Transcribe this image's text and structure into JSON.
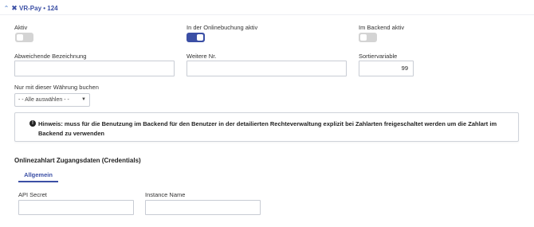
{
  "header": {
    "collapse_icon": "chevron-up",
    "method_icon": "x-mark",
    "title": "VR-Pay • 124"
  },
  "toggles": {
    "aktiv": {
      "label": "Aktiv",
      "on": false
    },
    "online": {
      "label": "In der Onlinebuchung aktiv",
      "on": true
    },
    "backend": {
      "label": "Im Backend aktiv",
      "on": false
    }
  },
  "fields": {
    "bezeichnung": {
      "label": "Abweichende Bezeichnung",
      "value": ""
    },
    "weitere_nr": {
      "label": "Weitere Nr.",
      "value": ""
    },
    "sortier": {
      "label": "Sortiervariable",
      "value": "99"
    }
  },
  "currency": {
    "label": "Nur mit dieser Währung buchen",
    "selected": "- - Alle auswählen - -"
  },
  "hint": {
    "icon": "info-icon",
    "text": "Hinweis: muss für die Benutzung im Backend für den Benutzer in der detailierten Rechteverwaltung explizit bei Zahlarten freigeschaltet werden um die Zahlart im Backend zu verwenden"
  },
  "credentials": {
    "section_title": "Onlinezahlart Zugangsdaten (Credentials)",
    "tab_label": "Allgemein",
    "api_secret": {
      "label": "API Secret",
      "value": ""
    },
    "instance_name": {
      "label": "Instance Name",
      "value": ""
    }
  },
  "colors": {
    "accent": "#3b4fa5",
    "toggle_off": "#d4d4d4",
    "border": "#c8ccd4"
  }
}
